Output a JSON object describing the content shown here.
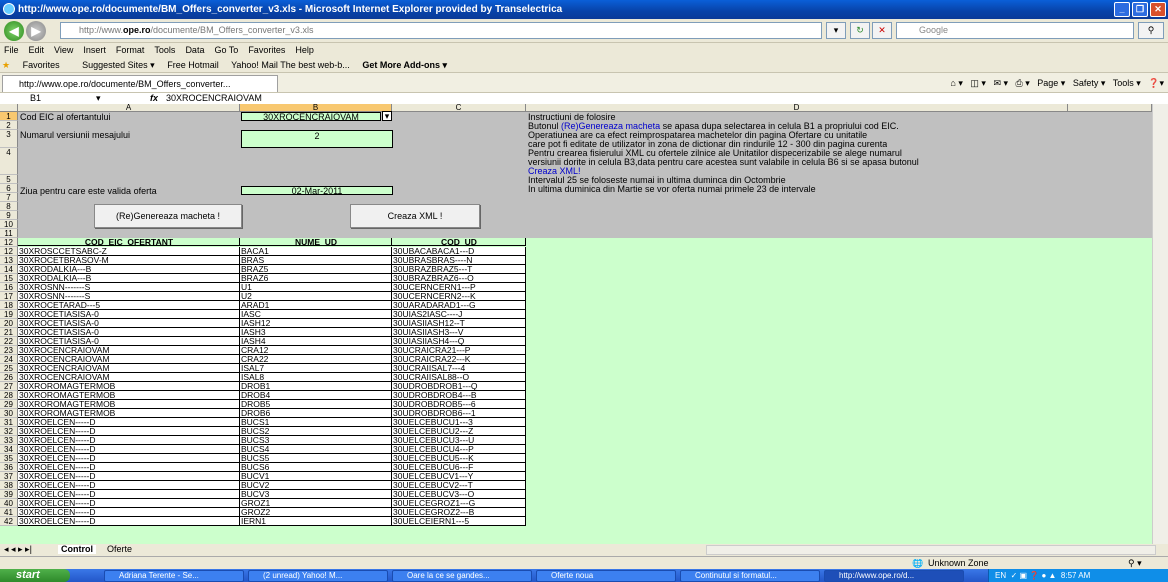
{
  "window": {
    "title": "http://www.ope.ro/documente/BM_Offers_converter_v3.xls - Microsoft Internet Explorer provided by Transelectrica"
  },
  "address": {
    "prefix": "http://www.",
    "domain": "ope.ro",
    "path": "/documente/BM_Offers_converter_v3.xls",
    "search_placeholder": "Google"
  },
  "menu": [
    "File",
    "Edit",
    "View",
    "Insert",
    "Format",
    "Tools",
    "Data",
    "Go To",
    "Favorites",
    "Help"
  ],
  "favorites": {
    "label": "Favorites",
    "items": [
      "Suggested Sites ▾",
      "Free Hotmail",
      "Yahoo! Mail The best web-b...",
      "Get More Add-ons ▾"
    ]
  },
  "tab": {
    "title": "http://www.ope.ro/documente/BM_Offers_converter..."
  },
  "tools": {
    "page": "Page ▾",
    "safety": "Safety ▾",
    "tools": "Tools ▾"
  },
  "formula": {
    "cellref": "B1",
    "fx": "fx",
    "value": "30XROCENCRAIOVAM"
  },
  "columns": [
    "A",
    "B",
    "C",
    "D"
  ],
  "form": {
    "r1_label": "Cod EIC al ofertantului",
    "r1_value": "30XROCENCRAIOVAM",
    "r3_label": "Numarul versiunii mesajului",
    "r3_value": "2",
    "r6_label": "Ziua pentru care este valida oferta",
    "r6_value": "02-Mar-2011",
    "btn_generate": "(Re)Genereaza macheta !",
    "btn_xml": "Creaza XML !"
  },
  "instructions": {
    "l1": "Instructiuni de folosire",
    "l2a": "Butonul ",
    "l2link": "(Re)Genereaza macheta",
    "l2b": " se apasa dupa selectarea in celula B1 a propriului cod EIC.",
    "l3": "Operatiunea are ca efect reimprospatarea machetelor din pagina Ofertare cu unitatile",
    "l4": "care pot fi editate de utilizator in zona de dictionar din rindurile 12 - 300 din pagina curenta",
    "l5": "Pentru crearea fisierului XML cu ofertele zilnice ale Unitatilor dispecerizabile se alege numarul",
    "l6": "versiunii dorite in celula B3,data pentru care acestea sunt valabile in celula B6 si se apasa butonul",
    "l7link": "Creaza XML!",
    "l8": "Intervalul 25 se foloseste numai in ultima duminca din Octombrie",
    "l9": "In ultima duminica din Martie se vor oferta numai primele 23 de intervale"
  },
  "table": {
    "headers": [
      "COD_EIC_OFERTANT",
      "NUME_UD",
      "COD_UD"
    ],
    "rows": [
      [
        "30XROSCCETSABC-Z",
        "BACA1",
        "30UBACABACA1---D"
      ],
      [
        "30XROCETBRASOV-M",
        "BRAS",
        "30UBRASBRAS----N"
      ],
      [
        "30XRODALKIA---B",
        "BRAZ5",
        "30UBRAZBRAZ5---T"
      ],
      [
        "30XRODALKIA---B",
        "BRAZ6",
        "30UBRAZBRAZ6---O"
      ],
      [
        "30XROSNN-------S",
        "U1",
        "30UCERNCERN1---P"
      ],
      [
        "30XROSNN-------S",
        "U2",
        "30UCERNCERN2---K"
      ],
      [
        "30XROCETARAD---5",
        "ARAD1",
        "30UARADARAD1---G"
      ],
      [
        "30XROCETIASISA-0",
        "IASC",
        "30UIAS2IASC----J"
      ],
      [
        "30XROCETIASISA-0",
        "IASH12",
        "30UIASIIASH12--T"
      ],
      [
        "30XROCETIASISA-0",
        "IASH3",
        "30UIASIIASH3---V"
      ],
      [
        "30XROCETIASISA-0",
        "IASH4",
        "30UIASIIASH4---Q"
      ],
      [
        "30XROCENCRAIOVAM",
        "CRA12",
        "30UCRAICRA21---P"
      ],
      [
        "30XROCENCRAIOVAM",
        "CRA22",
        "30UCRAICRA22---K"
      ],
      [
        "30XROCENCRAIOVAM",
        "ISAL7",
        "30UCRAIISAL7---4"
      ],
      [
        "30XROCENCRAIOVAM",
        "ISAL8",
        "30UCRAIISAL88--O"
      ],
      [
        "30XROROMAGTERMOB",
        "DROB1",
        "30UDROBDROB1---Q"
      ],
      [
        "30XROROMAGTERMOB",
        "DROB4",
        "30UDROBDROB4---B"
      ],
      [
        "30XROROMAGTERMOB",
        "DROB5",
        "30UDROBDROB5---6"
      ],
      [
        "30XROROMAGTERMOB",
        "DROB6",
        "30UDROBDROB6---1"
      ],
      [
        "30XROELCEN-----D",
        "BUCS1",
        "30UELCEBUCU1---3"
      ],
      [
        "30XROELCEN-----D",
        "BUCS2",
        "30UELCEBUCU2---Z"
      ],
      [
        "30XROELCEN-----D",
        "BUCS3",
        "30UELCEBUCU3---U"
      ],
      [
        "30XROELCEN-----D",
        "BUCS4",
        "30UELCEBUCU4---P"
      ],
      [
        "30XROELCEN-----D",
        "BUCS5",
        "30UELCEBUCU5---K"
      ],
      [
        "30XROELCEN-----D",
        "BUCS6",
        "30UELCEBUCU6---F"
      ],
      [
        "30XROELCEN-----D",
        "BUCV1",
        "30UELCEBUCV1---Y"
      ],
      [
        "30XROELCEN-----D",
        "BUCV2",
        "30UELCEBUCV2---T"
      ],
      [
        "30XROELCEN-----D",
        "BUCV3",
        "30UELCEBUCV3---O"
      ],
      [
        "30XROELCEN-----D",
        "GROZ1",
        "30UELCEGROZ1---G"
      ],
      [
        "30XROELCEN-----D",
        "GROZ2",
        "30UELCEGROZ2---B"
      ],
      [
        "30XROELCEN-----D",
        "IERN1",
        "30UELCEIERN1---5"
      ]
    ]
  },
  "sheets": {
    "active": "Control",
    "other": "Oferte"
  },
  "status": {
    "zone": "Unknown Zone"
  },
  "taskbar": {
    "start": "start",
    "items": [
      "Adriana Terente - Se...",
      "(2 unread) Yahoo! M...",
      "Oare la ce se gandes...",
      "Oferte noua",
      "Continutul si formatul...",
      "http://www.ope.ro/d..."
    ],
    "lang": "EN",
    "time": "8:57 AM"
  }
}
